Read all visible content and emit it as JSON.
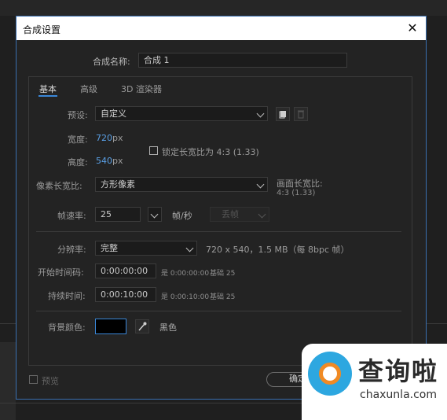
{
  "dialog": {
    "title": "合成设置",
    "close_glyph": "✕",
    "comp_name_label": "合成名称:",
    "comp_name_value": "合成 1",
    "tabs": [
      "基本",
      "高级",
      "3D 渲染器"
    ],
    "basic": {
      "preset_label": "预设:",
      "preset_value": "自定义",
      "width_label": "宽度:",
      "width_value": "720",
      "width_unit": "px",
      "height_label": "高度:",
      "height_value": "540",
      "height_unit": "px",
      "lock_aspect_label": "锁定长宽比为 4:3 (1.33)",
      "lock_aspect_checked": false,
      "pixel_aspect_label": "像素长宽比:",
      "pixel_aspect_value": "方形像素",
      "frame_aspect_label": "画面长宽比:",
      "frame_aspect_value": "4:3 (1.33)",
      "frame_rate_label": "帧速率:",
      "frame_rate_value": "25",
      "frame_rate_unit": "帧/秒",
      "drop_frame_value": "丢帧",
      "resolution_label": "分辨率:",
      "resolution_value": "完整",
      "resolution_info": "720 x 540，1.5 MB（每 8bpc 帧）",
      "start_tc_label": "开始时间码:",
      "start_tc_value": "0:00:00:00",
      "start_tc_info": "是 0:00:00:00",
      "start_tc_base": "基础 25",
      "duration_label": "持续时间:",
      "duration_value": "0:00:10:00",
      "duration_info": "是 0:00:10:00",
      "duration_base": "基础 25",
      "bg_color_label": "背景颜色:",
      "bg_color_value": "#000000",
      "bg_color_name": "黑色"
    },
    "preview_label": "预览",
    "ok_label": "确定"
  },
  "watermark": {
    "title": "查询啦",
    "url": "chaxunla.com"
  },
  "colors": {
    "accent": "#3a87d8",
    "value_blue": "#5aa0e6",
    "dialog_bg": "#232323"
  }
}
